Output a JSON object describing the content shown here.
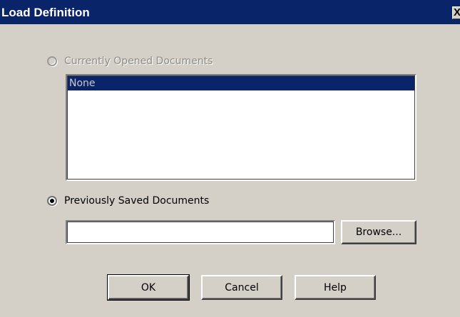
{
  "window": {
    "title": "Load Definition",
    "close_icon": "close-icon",
    "close_glyph": "X"
  },
  "options": {
    "currently_opened_label": "Currently Opened Documents",
    "currently_opened_enabled": false,
    "currently_opened_selected": false,
    "previously_saved_label": "Previously Saved Documents",
    "previously_saved_selected": true
  },
  "document_list": {
    "items": [
      "None"
    ],
    "selected_index": 0
  },
  "path_field": {
    "value": "",
    "placeholder": ""
  },
  "buttons": {
    "browse": "Browse...",
    "ok": "OK",
    "cancel": "Cancel",
    "help": "Help"
  },
  "colors": {
    "titlebar": "#0a246a",
    "dialog_face": "#d4d0c8",
    "selection": "#0a246a"
  }
}
